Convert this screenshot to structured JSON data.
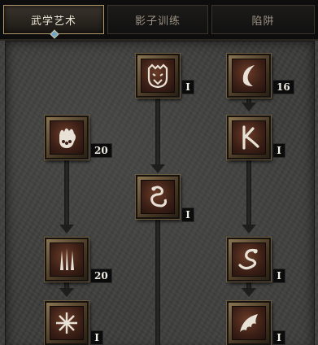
{
  "tabs": [
    {
      "label": "武学艺术",
      "active": true
    },
    {
      "label": "影子训练",
      "active": false
    },
    {
      "label": "陷阱",
      "active": false
    }
  ],
  "skills": [
    {
      "id": "tiger-strike",
      "icon": "tiger-head-icon",
      "level": "I"
    },
    {
      "id": "claw-mastery",
      "icon": "crescent-claw-icon",
      "level": "16"
    },
    {
      "id": "fists-of-fire",
      "icon": "flaming-fist-icon",
      "level": "20"
    },
    {
      "id": "dragon-talon",
      "icon": "kick-icon",
      "level": "I"
    },
    {
      "id": "cobra-strike",
      "icon": "serpent-coil-icon",
      "level": "I"
    },
    {
      "id": "claws-of-thunder",
      "icon": "triple-claw-icon",
      "level": "20"
    },
    {
      "id": "dragon-claw",
      "icon": "dragon-serpent-icon",
      "level": "I"
    },
    {
      "id": "blades-of-ice",
      "icon": "starburst-icon",
      "level": "I"
    },
    {
      "id": "dragon-tail",
      "icon": "dragon-wing-icon",
      "level": "I"
    }
  ],
  "colors": {
    "accent_border": "#b49a6a",
    "active_indicator": "#6fa7c4",
    "node_frame": "#8a7450"
  }
}
